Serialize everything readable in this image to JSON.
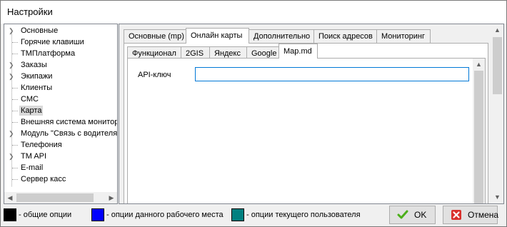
{
  "window": {
    "title": "Настройки"
  },
  "tree": {
    "items": [
      {
        "label": "Основные",
        "expandable": true
      },
      {
        "label": "Горячие клавиши",
        "expandable": false
      },
      {
        "label": "TMПлатформа",
        "expandable": false
      },
      {
        "label": "Заказы",
        "expandable": true
      },
      {
        "label": "Экипажи",
        "expandable": true
      },
      {
        "label": "Клиенты",
        "expandable": false
      },
      {
        "label": "СМС",
        "expandable": false
      },
      {
        "label": "Карта",
        "expandable": false,
        "selected": true
      },
      {
        "label": "Внешняя система мониторинга",
        "expandable": false
      },
      {
        "label": "Модуль \"Связь с водителями\"",
        "expandable": true
      },
      {
        "label": "Телефония",
        "expandable": false
      },
      {
        "label": "TM API",
        "expandable": true
      },
      {
        "label": "E-mail",
        "expandable": false
      },
      {
        "label": "Сервер касс",
        "expandable": false
      }
    ]
  },
  "tabs_main": [
    "Основные (mp)",
    "Онлайн карты",
    "Дополнительно",
    "Поиск адресов",
    "Мониторинг"
  ],
  "tabs_sub": [
    "Функционал",
    "2GIS",
    "Яндекс",
    "Google",
    "Map.md"
  ],
  "form": {
    "api_key_label": "API-ключ",
    "api_key_value": ""
  },
  "legend": [
    {
      "color": "#000000",
      "text": "- общие опции"
    },
    {
      "color": "#0000ff",
      "text": "- опции данного рабочего места"
    },
    {
      "color": "#008080",
      "text": "- опции текущего пользователя"
    }
  ],
  "buttons": {
    "ok": "OK",
    "cancel": "Отмена"
  }
}
